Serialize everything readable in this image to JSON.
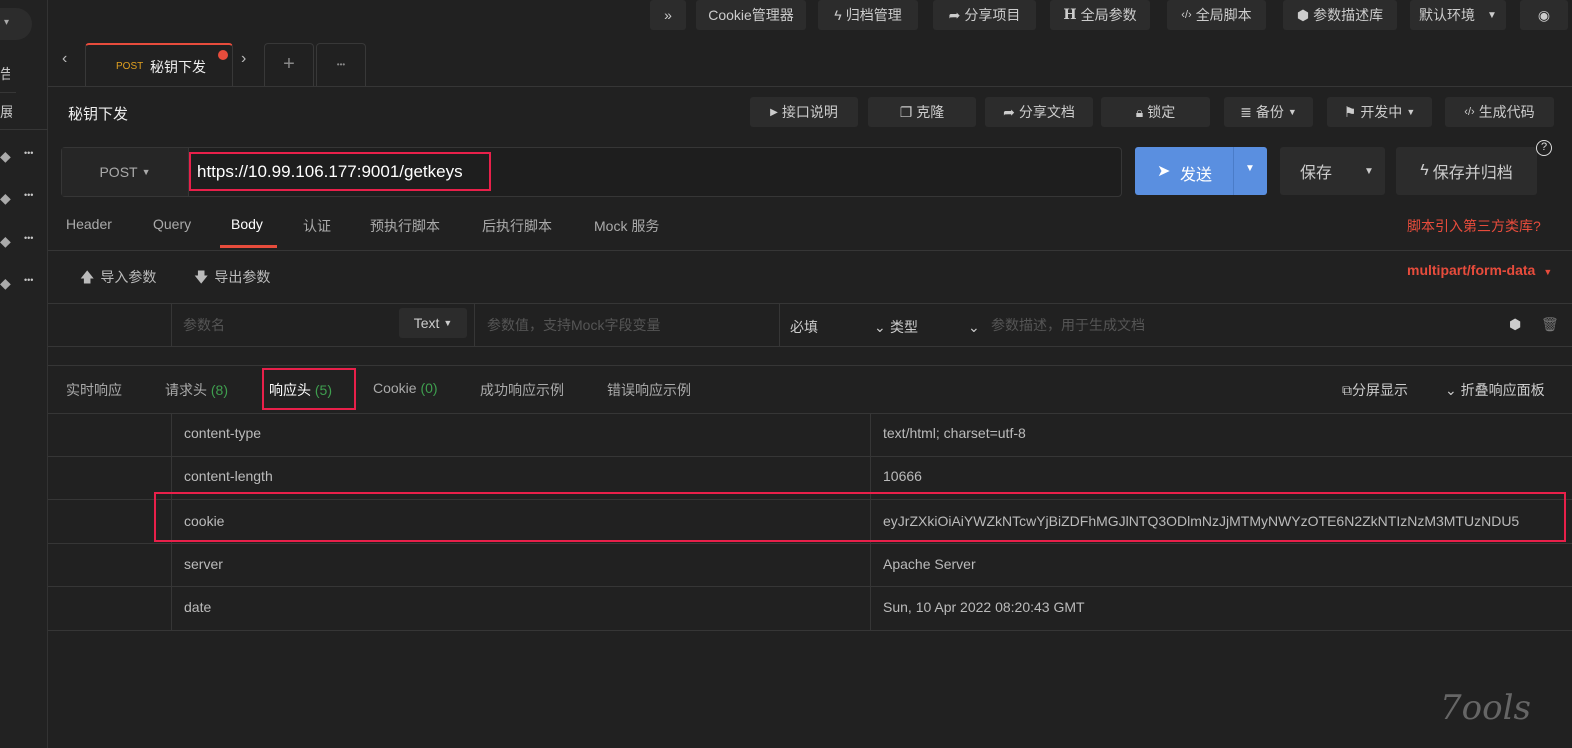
{
  "sidebar": {
    "partial_labels": [
      "告",
      "展"
    ],
    "row_actions": [
      "•••",
      "•••",
      "•••",
      "•••"
    ]
  },
  "toolbar": {
    "expand": "»",
    "cookie": "Cookie管理器",
    "archive": "归档管理",
    "share_project": "分享项目",
    "global_params": "全局参数",
    "global_script": "全局脚本",
    "param_lib": "参数描述库",
    "env": "默认环境"
  },
  "tabs": {
    "active_method": "POST",
    "active_title": "秘钥下发",
    "add": "+",
    "more": "•••"
  },
  "api": {
    "title": "秘钥下发",
    "buttons": [
      "接口说明",
      "克隆",
      "分享文档",
      "锁定",
      "备份",
      "开发中",
      "生成代码"
    ]
  },
  "request": {
    "method": "POST",
    "url": "https://10.99.106.177:9001/getkeys",
    "send": "发送",
    "save": "保存",
    "save_archive": "保存并归档",
    "help": "?"
  },
  "req_tabs": {
    "items": [
      "Header",
      "Query",
      "Body",
      "认证",
      "预执行脚本",
      "后执行脚本",
      "Mock 服务"
    ],
    "active": "Body",
    "script_link": "脚本引入第三方类库?"
  },
  "body": {
    "import": "导入参数",
    "export": "导出参数",
    "content_type": "multipart/form-data",
    "param_name_placeholder": "参数名",
    "type": "Text",
    "value_placeholder": "参数值，支持Mock字段变量",
    "required": "必填",
    "kind": "类型",
    "desc_placeholder": "参数描述，用于生成文档"
  },
  "resp_tabs": {
    "realtime": "实时响应",
    "req_headers": "请求头",
    "req_headers_count": "(8)",
    "resp_headers": "响应头",
    "resp_headers_count": "(5)",
    "cookie": "Cookie",
    "cookie_count": "(0)",
    "success_example": "成功响应示例",
    "error_example": "错误响应示例",
    "split": "分屏显示",
    "collapse": "折叠响应面板"
  },
  "headers": [
    {
      "name": "content-type",
      "value": "text/html; charset=utf-8"
    },
    {
      "name": "content-length",
      "value": "10666"
    },
    {
      "name": "cookie",
      "value": "eyJrZXkiOiAiYWZkNTcwYjBiZDFhMGJlNTQ3ODlmNzJjMTMyNWYzOTE6N2ZkNTIzNzM3MTUzNDU5"
    },
    {
      "name": "server",
      "value": "Apache Server"
    },
    {
      "name": "date",
      "value": "Sun, 10 Apr 2022 08:20:43 GMT"
    }
  ],
  "watermark": "7ools",
  "colors": {
    "accent": "#e74c3c",
    "send": "#5a8fe0",
    "highlight": "#e8204a",
    "count": "#3f9f4f"
  }
}
